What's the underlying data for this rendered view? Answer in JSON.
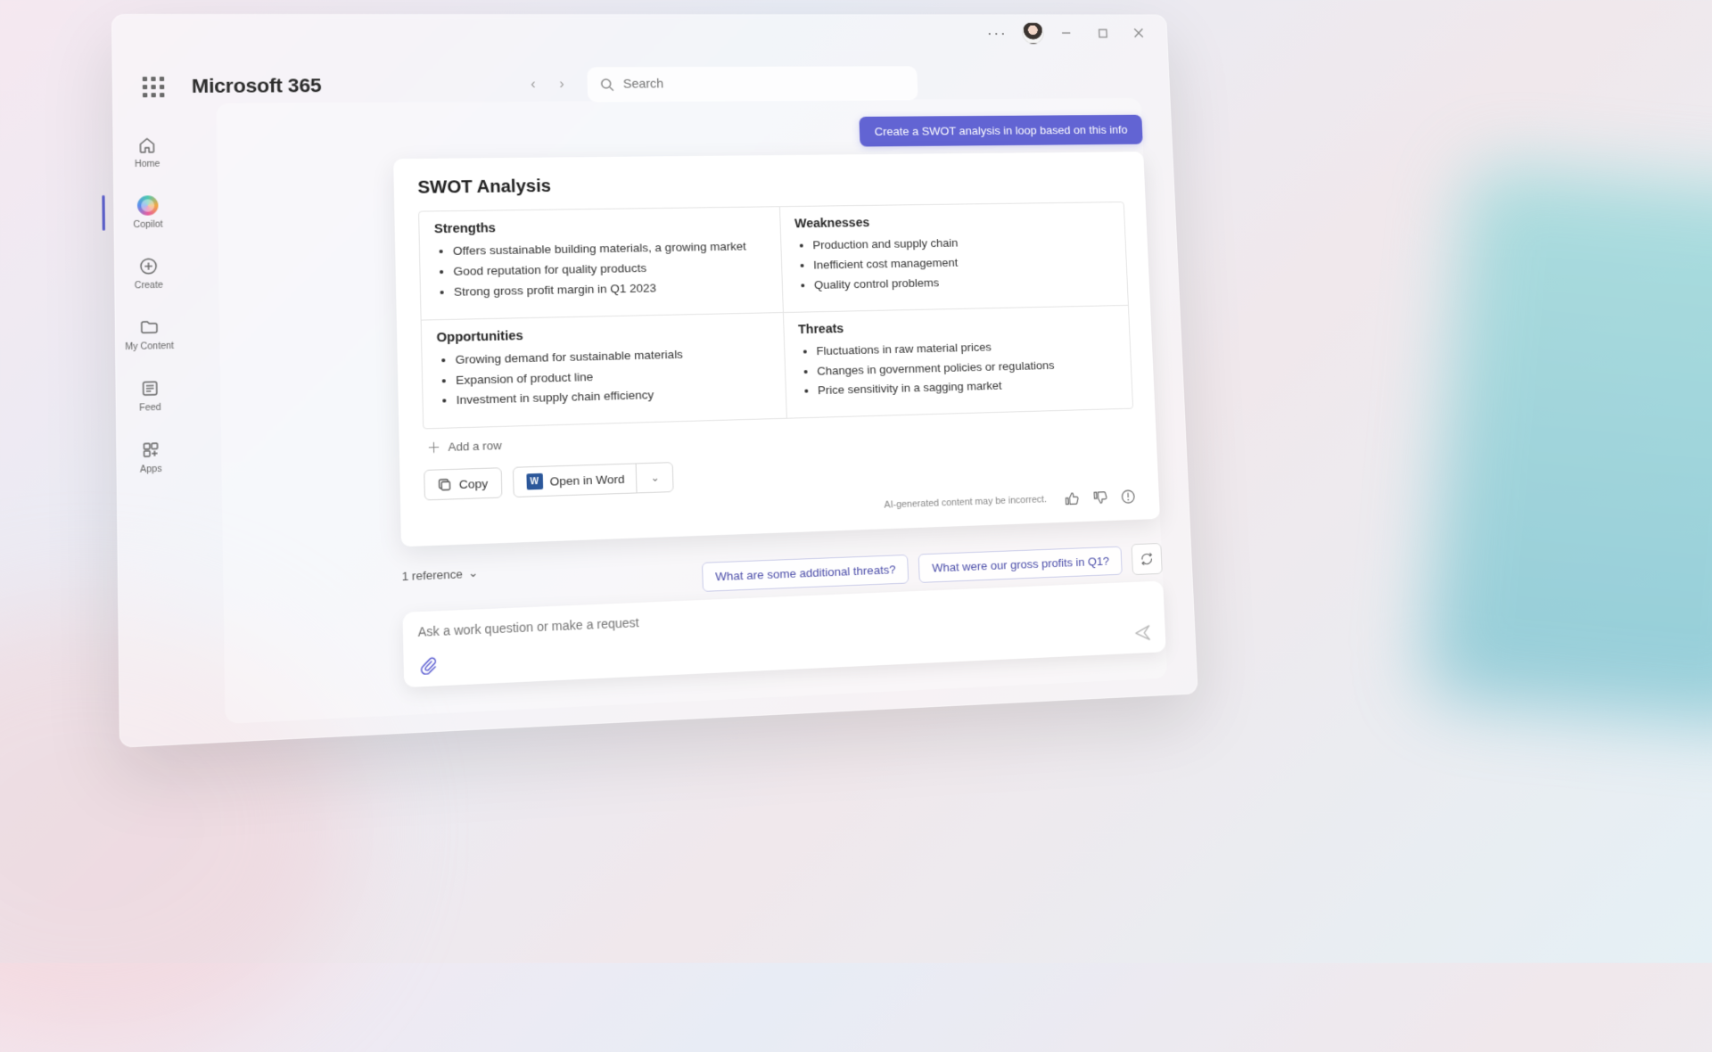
{
  "app": {
    "brand": "Microsoft 365"
  },
  "search": {
    "placeholder": "Search"
  },
  "sidebar": {
    "items": [
      {
        "label": "Home"
      },
      {
        "label": "Copilot"
      },
      {
        "label": "Create"
      },
      {
        "label": "My Content"
      },
      {
        "label": "Feed"
      },
      {
        "label": "Apps"
      }
    ]
  },
  "chat": {
    "user_prompt": "Create a SWOT analysis in loop based on this info",
    "card": {
      "title": "SWOT Analysis",
      "quadrants": {
        "strengths": {
          "title": "Strengths",
          "items": [
            "Offers sustainable building materials, a growing market",
            "Good reputation for quality products",
            "Strong gross profit margin in Q1 2023"
          ]
        },
        "weaknesses": {
          "title": "Weaknesses",
          "items": [
            "Production and supply chain",
            "Inefficient cost management",
            "Quality control problems"
          ]
        },
        "opportunities": {
          "title": "Opportunities",
          "items": [
            "Growing demand for sustainable materials",
            "Expansion of product line",
            "Investment in supply chain efficiency"
          ]
        },
        "threats": {
          "title": "Threats",
          "items": [
            "Fluctuations in raw material prices",
            "Changes in government policies or regulations",
            "Price sensitivity in a sagging market"
          ]
        }
      },
      "add_row": "Add a row",
      "copy_label": "Copy",
      "open_word_label": "Open in Word",
      "disclaimer": "AI-generated content may be incorrect.",
      "reference_label": "1 reference"
    },
    "suggestions": [
      "What are some additional threats?",
      "What were our gross profits in Q1?"
    ],
    "input_placeholder": "Ask a work question or make a request"
  }
}
